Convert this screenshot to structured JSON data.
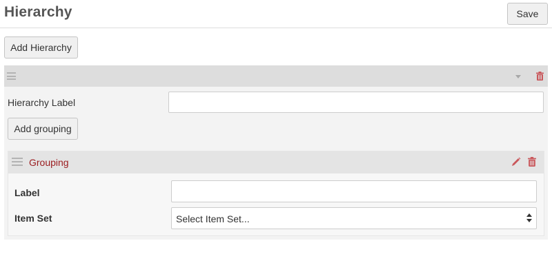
{
  "header": {
    "title": "Hierarchy",
    "save_label": "Save"
  },
  "toolbar": {
    "add_hierarchy_label": "Add Hierarchy"
  },
  "hierarchy": {
    "label_caption": "Hierarchy Label",
    "label_value": "",
    "add_grouping_label": "Add grouping",
    "icons": [
      "drag-handle-icon",
      "collapse-arrow-icon",
      "trash-icon"
    ],
    "grouping": {
      "title": "Grouping",
      "label_caption": "Label",
      "label_value": "",
      "item_set_caption": "Item Set",
      "item_set_selected": "Select Item Set...",
      "icons": [
        "drag-handle-icon",
        "pencil-icon",
        "trash-icon"
      ]
    }
  },
  "colors": {
    "accent_red": "#c9565a",
    "grouping_title": "#9b1d20",
    "bar_gray": "#dddddd"
  }
}
